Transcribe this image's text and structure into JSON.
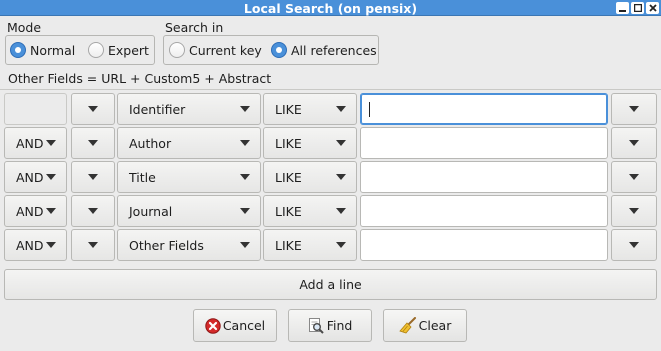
{
  "window": {
    "title": "Local Search (on pensix)",
    "controls": [
      "minimize",
      "maximize",
      "close"
    ]
  },
  "mode": {
    "title": "Mode",
    "options": [
      {
        "label": "Normal",
        "selected": true
      },
      {
        "label": "Expert",
        "selected": false
      }
    ]
  },
  "search_in": {
    "title": "Search in",
    "options": [
      {
        "label": "Current key",
        "selected": false
      },
      {
        "label": "All references",
        "selected": true
      }
    ]
  },
  "info_line": "Other Fields = URL + Custom5 + Abstract",
  "rows": [
    {
      "connector": "",
      "field": "Identifier",
      "operator": "LIKE",
      "value": "",
      "focused": true
    },
    {
      "connector": "AND",
      "field": "Author",
      "operator": "LIKE",
      "value": "",
      "focused": false
    },
    {
      "connector": "AND",
      "field": "Title",
      "operator": "LIKE",
      "value": "",
      "focused": false
    },
    {
      "connector": "AND",
      "field": "Journal",
      "operator": "LIKE",
      "value": "",
      "focused": false
    },
    {
      "connector": "AND",
      "field": "Other Fields",
      "operator": "LIKE",
      "value": "",
      "focused": false
    }
  ],
  "add_line_label": "Add a line",
  "buttons": {
    "cancel": {
      "label": "Cancel",
      "icon": "cancel-icon"
    },
    "find": {
      "label": "Find",
      "icon": "find-icon"
    },
    "clear": {
      "label": "Clear",
      "icon": "broom-icon"
    }
  },
  "colors": {
    "titlebar": "#4a90d9",
    "focus": "#4a90d9",
    "window_bg": "#ebebeb"
  }
}
